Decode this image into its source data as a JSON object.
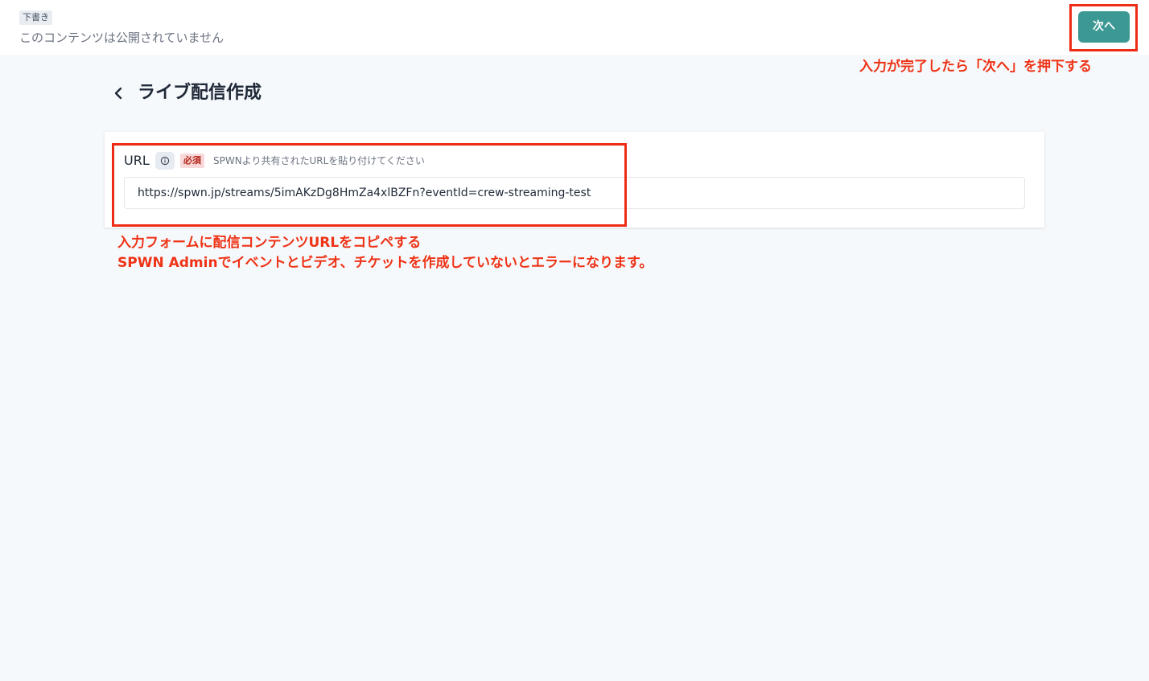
{
  "header": {
    "status_badge": "下書き",
    "status_text": "このコンテンツは公開されていません",
    "next_label": "次へ"
  },
  "page": {
    "title": "ライブ配信作成"
  },
  "form": {
    "url_label": "URL",
    "required_label": "必須",
    "hint": "SPWNより共有されたURLを貼り付けてください",
    "url_value": "https://spwn.jp/streams/5imAKzDg8HmZa4xlBZFn?eventId=crew-streaming-test"
  },
  "annotations": {
    "next": "入力が完了したら「次へ」を押下する",
    "url_line1": "入力フォームに配信コンテンツURLをコピペする",
    "url_line2": "SPWN Adminでイベントとビデオ、チケットを作成していないとエラーになります。"
  },
  "colors": {
    "primary": "#3b9893",
    "annotation": "#ee2b14",
    "background": "#f6f9fc"
  }
}
